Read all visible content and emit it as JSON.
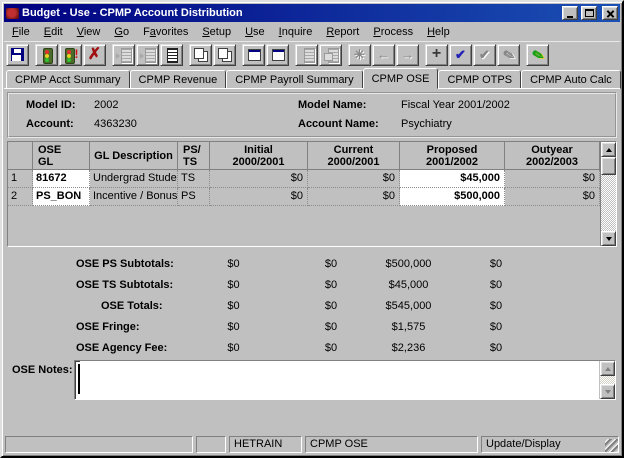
{
  "window": {
    "title": "Budget - Use - CPMP Account Distribution"
  },
  "menu": {
    "items": [
      {
        "label": "File",
        "underline": 0
      },
      {
        "label": "Edit",
        "underline": 0
      },
      {
        "label": "View",
        "underline": 0
      },
      {
        "label": "Go",
        "underline": 0
      },
      {
        "label": "Favorites",
        "underline": 1
      },
      {
        "label": "Setup",
        "underline": 0
      },
      {
        "label": "Use",
        "underline": 0
      },
      {
        "label": "Inquire",
        "underline": 0
      },
      {
        "label": "Report",
        "underline": 0
      },
      {
        "label": "Process",
        "underline": 0
      },
      {
        "label": "Help",
        "underline": 0
      }
    ]
  },
  "toolbar": {
    "buttons": [
      {
        "name": "save-button",
        "icon": "floppy-icon",
        "enabled": true
      },
      {
        "name": "run-button",
        "icon": "traffic-light-icon",
        "enabled": true,
        "sep": true
      },
      {
        "name": "run-alert-button",
        "icon": "traffic-light-exclamation-icon",
        "enabled": true,
        "glyph": "!",
        "color": "#d01010"
      },
      {
        "name": "delete-button",
        "icon": "delete-x-icon",
        "enabled": true,
        "glyph": "✗",
        "color": "#a01010"
      },
      {
        "name": "insert-row-button",
        "icon": "form-insert-icon",
        "enabled": false,
        "sep": true
      },
      {
        "name": "append-row-button",
        "icon": "form-append-icon",
        "enabled": false
      },
      {
        "name": "list-button",
        "icon": "list-icon",
        "enabled": true
      },
      {
        "name": "copy-model-button",
        "icon": "copy-pages-down-icon",
        "enabled": true,
        "sep": true,
        "glyph": "↘",
        "color": "#c01010"
      },
      {
        "name": "paste-model-button",
        "icon": "copy-pages-up-icon",
        "enabled": true,
        "glyph": "↖",
        "color": "#c01010"
      },
      {
        "name": "drill-down-button",
        "icon": "window-down-icon",
        "enabled": true,
        "sep": true,
        "glyph": "↘",
        "color": "#c01010"
      },
      {
        "name": "drill-up-button",
        "icon": "window-up-icon",
        "enabled": true,
        "glyph": "↖",
        "color": "#c01010"
      },
      {
        "name": "report-button",
        "icon": "report-icon",
        "enabled": false,
        "sep": true
      },
      {
        "name": "report-window-button",
        "icon": "report-window-icon",
        "enabled": false
      },
      {
        "name": "process-button",
        "icon": "gear-icon",
        "enabled": false,
        "sep": true,
        "glyph": "✳"
      },
      {
        "name": "back-button",
        "icon": "arrow-left-icon",
        "enabled": false,
        "glyph": "←"
      },
      {
        "name": "forward-button",
        "icon": "arrow-right-icon",
        "enabled": false,
        "glyph": "→"
      },
      {
        "name": "add-button",
        "icon": "plus-icon",
        "enabled": true,
        "sep": true,
        "glyph": "+",
        "color": "#383838"
      },
      {
        "name": "approve-button",
        "icon": "check-icon",
        "enabled": true,
        "glyph": "✔",
        "color": "#2121b5"
      },
      {
        "name": "approve-all-button",
        "icon": "double-check-icon",
        "enabled": false,
        "glyph": "✔"
      },
      {
        "name": "edit-pencil-button",
        "icon": "pencil-icon",
        "enabled": false,
        "glyph": "✎"
      },
      {
        "name": "notes-pen-button",
        "icon": "pen-icon",
        "enabled": true,
        "sep": true,
        "glyph": "✎",
        "color": "#18a018"
      }
    ]
  },
  "tabs": {
    "items": [
      {
        "label": "CPMP Acct Summary",
        "active": false
      },
      {
        "label": "CPMP Revenue",
        "active": false
      },
      {
        "label": "CPMP Payroll Summary",
        "active": false
      },
      {
        "label": "CPMP OSE",
        "active": true
      },
      {
        "label": "CPMP OTPS",
        "active": false
      },
      {
        "label": "CPMP Auto Calc",
        "active": false
      }
    ]
  },
  "info": {
    "model_id_label": "Model ID:",
    "model_id_value": "2002",
    "model_name_label": "Model Name:",
    "model_name_value": "Fiscal Year 2001/2002",
    "account_label": "Account:",
    "account_value": "4363230",
    "account_name_label": "Account Name:",
    "account_name_value": "Psychiatry"
  },
  "grid": {
    "headers": [
      {
        "line1": "OSE",
        "line2": "GL"
      },
      {
        "line1": "GL Description",
        "line2": ""
      },
      {
        "line1": "PS/",
        "line2": "TS"
      },
      {
        "line1": "Initial",
        "line2": "2000/2001"
      },
      {
        "line1": "Current",
        "line2": "2000/2001"
      },
      {
        "line1": "Proposed",
        "line2": "2001/2002"
      },
      {
        "line1": "Outyear",
        "line2": "2002/2003"
      }
    ],
    "rows": [
      {
        "num": "1",
        "gl": "81672",
        "desc": "Undergrad Stude",
        "ps_ts": "TS",
        "initial": "$0",
        "current": "$0",
        "proposed": "$45,000",
        "outyear": "$0"
      },
      {
        "num": "2",
        "gl": "PS_BON",
        "desc": "Incentive / Bonus",
        "ps_ts": "PS",
        "initial": "$0",
        "current": "$0",
        "proposed": "$500,000",
        "outyear": "$0"
      }
    ]
  },
  "subtotals": {
    "rows": [
      {
        "label": "OSE PS Subtotals:",
        "values": [
          "$0",
          "$0",
          "$500,000",
          "$0"
        ]
      },
      {
        "label": "OSE TS Subtotals:",
        "values": [
          "$0",
          "$0",
          "$45,000",
          "$0"
        ]
      },
      {
        "label": "OSE Totals:",
        "values": [
          "$0",
          "$0",
          "$545,000",
          "$0"
        ]
      },
      {
        "label": "OSE Fringe:",
        "values": [
          "$0",
          "$0",
          "$1,575",
          "$0"
        ]
      },
      {
        "label": "OSE Agency Fee:",
        "values": [
          "$0",
          "$0",
          "$2,236",
          "$0"
        ]
      }
    ]
  },
  "notes": {
    "label": "OSE Notes:",
    "value": ""
  },
  "statusbar": {
    "panels": [
      "",
      "",
      "HETRAIN",
      "CPMP OSE",
      "Update/Display"
    ]
  },
  "colors": {
    "titlebar": "#000080",
    "delete_red": "#a01010",
    "check_blue": "#2121b5",
    "pen_green": "#18a018",
    "editable_white": "#ffffff"
  }
}
